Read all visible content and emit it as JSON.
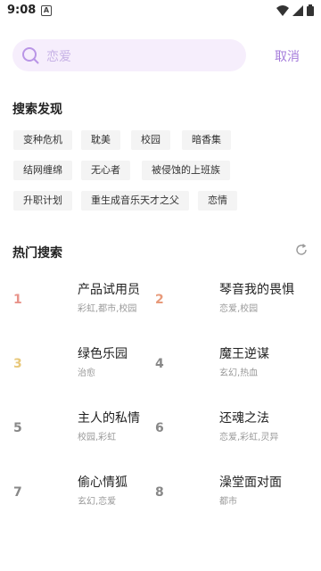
{
  "status_bar": {
    "time": "9:08",
    "notification_icon": "A"
  },
  "search": {
    "placeholder": "恋爱",
    "cancel_label": "取消",
    "accent_color": "#a57cdb",
    "bar_color": "#f6eefc"
  },
  "discover": {
    "title": "搜索发现",
    "tags": [
      "变种危机",
      "耽美",
      "校园",
      "暗香集",
      "结网缠绵",
      "无心者",
      "被侵蚀的上班族",
      "升职计划",
      "重生成音乐天才之父",
      "恋情"
    ]
  },
  "hot": {
    "title": "热门搜索",
    "rank_colors": {
      "1": "#e8938a",
      "2": "#e89a7a",
      "3": "#e8c87a",
      "default": "#888888"
    },
    "items": [
      {
        "rank": "1",
        "title": "产品试用员",
        "tags": "彩虹,都市,校园"
      },
      {
        "rank": "2",
        "title": "琴音我的畏惧",
        "tags": "恋爱,校园"
      },
      {
        "rank": "3",
        "title": "绿色乐园",
        "tags": "治愈"
      },
      {
        "rank": "4",
        "title": "魔王逆谋",
        "tags": "玄幻,热血"
      },
      {
        "rank": "5",
        "title": "主人的私情",
        "tags": "校园,彩虹"
      },
      {
        "rank": "6",
        "title": "还魂之法",
        "tags": "恋爱,彩虹,灵异"
      },
      {
        "rank": "7",
        "title": "偷心情狐",
        "tags": "玄幻,恋爱"
      },
      {
        "rank": "8",
        "title": "澡堂面对面",
        "tags": "都市"
      }
    ]
  }
}
